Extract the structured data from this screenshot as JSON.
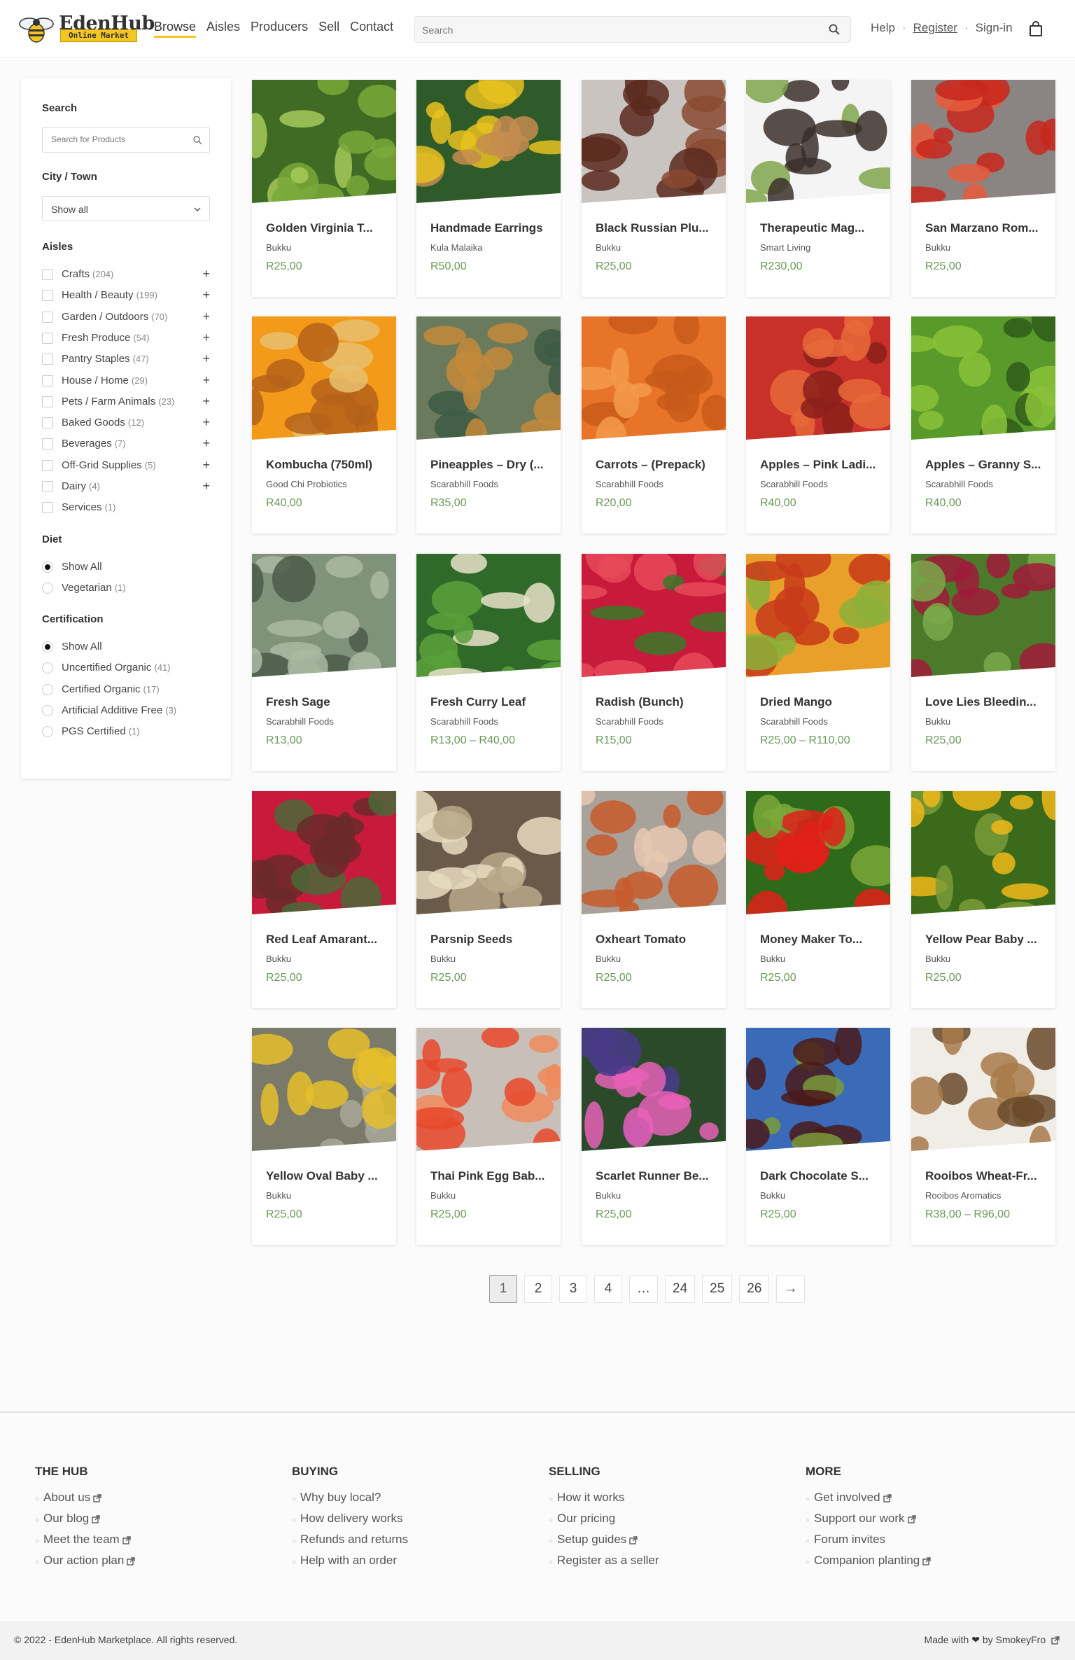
{
  "brand": {
    "name": "EdenHub",
    "tagline": "Online Market",
    "accent": "#f3c623"
  },
  "nav": {
    "items": [
      "Browse",
      "Aisles",
      "Producers",
      "Sell",
      "Contact"
    ],
    "active": "Browse"
  },
  "search": {
    "placeholder": "Search"
  },
  "header_links": {
    "help": "Help",
    "register": "Register",
    "signin": "Sign-in",
    "separator": "·"
  },
  "sidebar": {
    "search_heading": "Search",
    "search_placeholder": "Search for Products",
    "city_heading": "City / Town",
    "city_value": "Show all",
    "aisles_heading": "Aisles",
    "aisles": [
      {
        "label": "Crafts",
        "count": "(204)",
        "expandable": true
      },
      {
        "label": "Health / Beauty",
        "count": "(199)",
        "expandable": true
      },
      {
        "label": "Garden / Outdoors",
        "count": "(70)",
        "expandable": true
      },
      {
        "label": "Fresh Produce",
        "count": "(54)",
        "expandable": true
      },
      {
        "label": "Pantry Staples",
        "count": "(47)",
        "expandable": true
      },
      {
        "label": "House / Home",
        "count": "(29)",
        "expandable": true
      },
      {
        "label": "Pets / Farm Animals",
        "count": "(23)",
        "expandable": true
      },
      {
        "label": "Baked Goods",
        "count": "(12)",
        "expandable": true
      },
      {
        "label": "Beverages",
        "count": "(7)",
        "expandable": true
      },
      {
        "label": "Off-Grid Supplies",
        "count": "(5)",
        "expandable": true
      },
      {
        "label": "Dairy",
        "count": "(4)",
        "expandable": true
      },
      {
        "label": "Services",
        "count": "(1)",
        "expandable": false
      }
    ],
    "diet_heading": "Diet",
    "diet": [
      {
        "label": "Show All",
        "count": "",
        "selected": true
      },
      {
        "label": "Vegetarian",
        "count": "(1)",
        "selected": false
      }
    ],
    "cert_heading": "Certification",
    "certification": [
      {
        "label": "Show All",
        "count": "",
        "selected": true
      },
      {
        "label": "Uncertified Organic",
        "count": "(41)",
        "selected": false
      },
      {
        "label": "Certified Organic",
        "count": "(17)",
        "selected": false
      },
      {
        "label": "Artificial Additive Free",
        "count": "(3)",
        "selected": false
      },
      {
        "label": "PGS Certified",
        "count": "(1)",
        "selected": false
      }
    ]
  },
  "products": [
    {
      "name": "Golden Virginia T...",
      "producer": "Bukku",
      "price": "R25,00",
      "image": "green-leafy-plants"
    },
    {
      "name": "Handmade Earrings",
      "producer": "Kula Malaika",
      "price": "R50,00",
      "image": "yellow-beaded-earring"
    },
    {
      "name": "Black Russian Plu...",
      "producer": "Bukku",
      "price": "R25,00",
      "image": "dark-tomatoes"
    },
    {
      "name": "Therapeutic Mag...",
      "producer": "Smart Living",
      "price": "R230,00",
      "image": "spray-bottles"
    },
    {
      "name": "San Marzano Rom...",
      "producer": "Bukku",
      "price": "R25,00",
      "image": "sliced-red-tomatoes"
    },
    {
      "name": "Kombucha (750ml)",
      "producer": "Good Chi Probiotics",
      "price": "R40,00",
      "image": "kombucha-bottles"
    },
    {
      "name": "Pineapples – Dry (...",
      "producer": "Scarabhill Foods",
      "price": "R35,00",
      "image": "pineapples"
    },
    {
      "name": "Carrots – (Prepack)",
      "producer": "Scarabhill Foods",
      "price": "R20,00",
      "image": "carrots"
    },
    {
      "name": "Apples – Pink Ladi...",
      "producer": "Scarabhill Foods",
      "price": "R40,00",
      "image": "red-apples"
    },
    {
      "name": "Apples – Granny S...",
      "producer": "Scarabhill Foods",
      "price": "R40,00",
      "image": "green-apples"
    },
    {
      "name": "Fresh Sage",
      "producer": "Scarabhill Foods",
      "price": "R13,00",
      "image": "sage-leaves"
    },
    {
      "name": "Fresh Curry Leaf",
      "producer": "Scarabhill Foods",
      "price": "R13,00 – R40,00",
      "image": "curry-leaves"
    },
    {
      "name": "Radish (Bunch)",
      "producer": "Scarabhill Foods",
      "price": "R15,00",
      "image": "radishes"
    },
    {
      "name": "Dried Mango",
      "producer": "Scarabhill Foods",
      "price": "R25,00 – R110,00",
      "image": "mangoes"
    },
    {
      "name": "Love Lies Bleedin...",
      "producer": "Bukku",
      "price": "R25,00",
      "image": "amaranth-flowers"
    },
    {
      "name": "Red Leaf Amarant...",
      "producer": "Bukku",
      "price": "R25,00",
      "image": "red-leaf-plant"
    },
    {
      "name": "Parsnip Seeds",
      "producer": "Bukku",
      "price": "R25,00",
      "image": "parsnips"
    },
    {
      "name": "Oxheart Tomato",
      "producer": "Bukku",
      "price": "R25,00",
      "image": "oxheart-tomato"
    },
    {
      "name": "Money Maker To...",
      "producer": "Bukku",
      "price": "R25,00",
      "image": "red-tomatoes-vine"
    },
    {
      "name": "Yellow Pear Baby ...",
      "producer": "Bukku",
      "price": "R25,00",
      "image": "yellow-pear-tomatoes"
    },
    {
      "name": "Yellow Oval Baby ...",
      "producer": "Bukku",
      "price": "R25,00",
      "image": "yellow-oval-tomatoes"
    },
    {
      "name": "Thai Pink Egg Bab...",
      "producer": "Bukku",
      "price": "R25,00",
      "image": "pink-egg-tomatoes"
    },
    {
      "name": "Scarlet Runner Be...",
      "producer": "Bukku",
      "price": "R25,00",
      "image": "runner-beans"
    },
    {
      "name": "Dark Chocolate S...",
      "producer": "Bukku",
      "price": "R25,00",
      "image": "dark-sunflower"
    },
    {
      "name": "Rooibos Wheat-Fr...",
      "producer": "Rooibos Aromatics",
      "price": "R38,00 – R96,00",
      "image": "rooibos-package"
    }
  ],
  "pagination": {
    "pages": [
      "1",
      "2",
      "3",
      "4",
      "…",
      "24",
      "25",
      "26"
    ],
    "current": "1",
    "next": "→"
  },
  "footer": {
    "columns": [
      {
        "title": "THE HUB",
        "links": [
          {
            "label": "About us",
            "external": true
          },
          {
            "label": "Our blog",
            "external": true
          },
          {
            "label": "Meet the team",
            "external": true
          },
          {
            "label": "Our action plan",
            "external": true
          }
        ]
      },
      {
        "title": "BUYING",
        "links": [
          {
            "label": "Why buy local?",
            "external": false
          },
          {
            "label": "How delivery works",
            "external": false
          },
          {
            "label": "Refunds and returns",
            "external": false
          },
          {
            "label": "Help with an order",
            "external": false
          }
        ]
      },
      {
        "title": "SELLING",
        "links": [
          {
            "label": "How it works",
            "external": false
          },
          {
            "label": "Our pricing",
            "external": false
          },
          {
            "label": "Setup guides",
            "external": true
          },
          {
            "label": "Register as a seller",
            "external": false
          }
        ]
      },
      {
        "title": "MORE",
        "links": [
          {
            "label": "Get involved",
            "external": true
          },
          {
            "label": "Support our work",
            "external": true
          },
          {
            "label": "Forum invites",
            "external": false
          },
          {
            "label": "Companion planting",
            "external": true
          }
        ]
      }
    ],
    "copyright": "© 2022 - EdenHub Marketplace. All rights reserved.",
    "made_with": "Made with",
    "by": "by SmokeyFro"
  },
  "colors": {
    "price": "#6a9a58"
  }
}
